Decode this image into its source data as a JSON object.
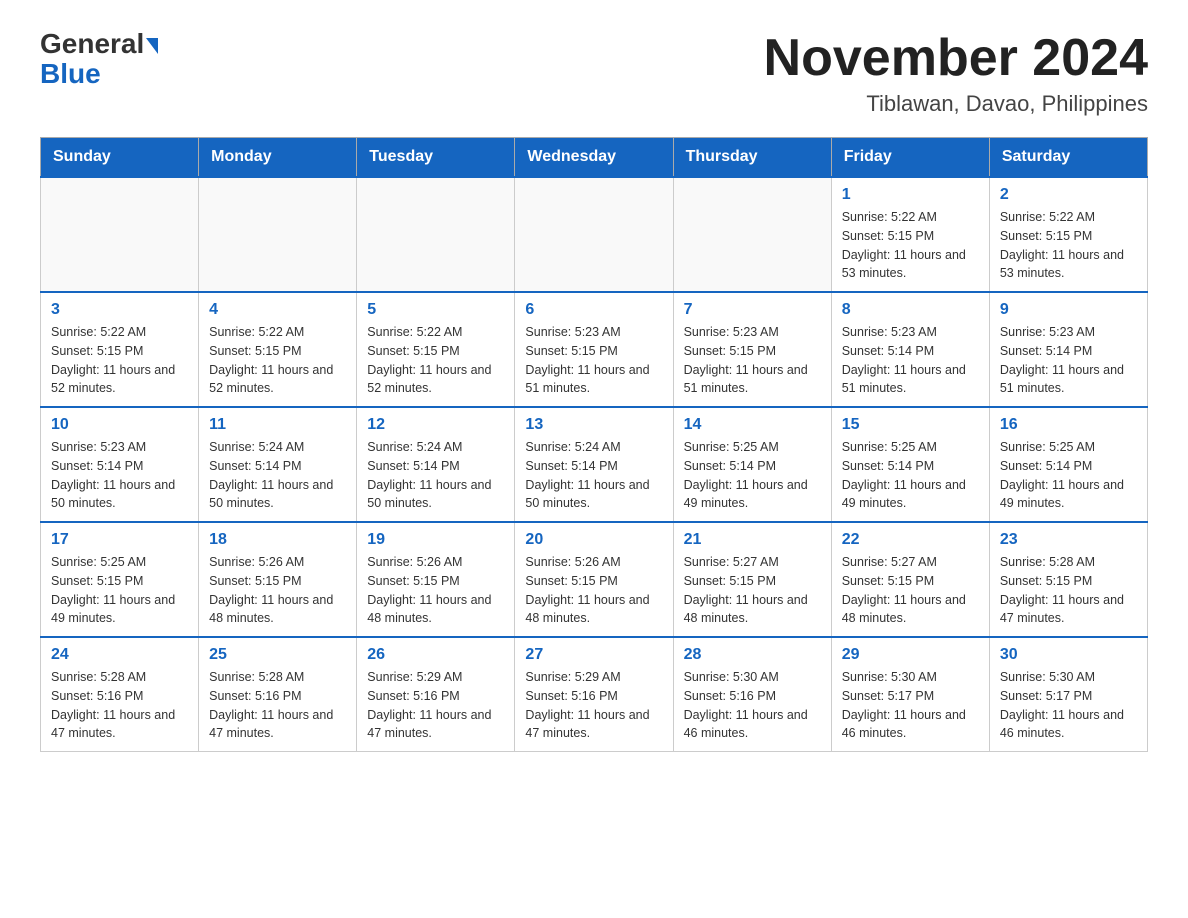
{
  "header": {
    "logo_general": "General",
    "logo_blue": "Blue",
    "month_year": "November 2024",
    "location": "Tiblawan, Davao, Philippines"
  },
  "weekdays": [
    "Sunday",
    "Monday",
    "Tuesday",
    "Wednesday",
    "Thursday",
    "Friday",
    "Saturday"
  ],
  "weeks": [
    [
      {
        "day": "",
        "info": ""
      },
      {
        "day": "",
        "info": ""
      },
      {
        "day": "",
        "info": ""
      },
      {
        "day": "",
        "info": ""
      },
      {
        "day": "",
        "info": ""
      },
      {
        "day": "1",
        "info": "Sunrise: 5:22 AM\nSunset: 5:15 PM\nDaylight: 11 hours and 53 minutes."
      },
      {
        "day": "2",
        "info": "Sunrise: 5:22 AM\nSunset: 5:15 PM\nDaylight: 11 hours and 53 minutes."
      }
    ],
    [
      {
        "day": "3",
        "info": "Sunrise: 5:22 AM\nSunset: 5:15 PM\nDaylight: 11 hours and 52 minutes."
      },
      {
        "day": "4",
        "info": "Sunrise: 5:22 AM\nSunset: 5:15 PM\nDaylight: 11 hours and 52 minutes."
      },
      {
        "day": "5",
        "info": "Sunrise: 5:22 AM\nSunset: 5:15 PM\nDaylight: 11 hours and 52 minutes."
      },
      {
        "day": "6",
        "info": "Sunrise: 5:23 AM\nSunset: 5:15 PM\nDaylight: 11 hours and 51 minutes."
      },
      {
        "day": "7",
        "info": "Sunrise: 5:23 AM\nSunset: 5:15 PM\nDaylight: 11 hours and 51 minutes."
      },
      {
        "day": "8",
        "info": "Sunrise: 5:23 AM\nSunset: 5:14 PM\nDaylight: 11 hours and 51 minutes."
      },
      {
        "day": "9",
        "info": "Sunrise: 5:23 AM\nSunset: 5:14 PM\nDaylight: 11 hours and 51 minutes."
      }
    ],
    [
      {
        "day": "10",
        "info": "Sunrise: 5:23 AM\nSunset: 5:14 PM\nDaylight: 11 hours and 50 minutes."
      },
      {
        "day": "11",
        "info": "Sunrise: 5:24 AM\nSunset: 5:14 PM\nDaylight: 11 hours and 50 minutes."
      },
      {
        "day": "12",
        "info": "Sunrise: 5:24 AM\nSunset: 5:14 PM\nDaylight: 11 hours and 50 minutes."
      },
      {
        "day": "13",
        "info": "Sunrise: 5:24 AM\nSunset: 5:14 PM\nDaylight: 11 hours and 50 minutes."
      },
      {
        "day": "14",
        "info": "Sunrise: 5:25 AM\nSunset: 5:14 PM\nDaylight: 11 hours and 49 minutes."
      },
      {
        "day": "15",
        "info": "Sunrise: 5:25 AM\nSunset: 5:14 PM\nDaylight: 11 hours and 49 minutes."
      },
      {
        "day": "16",
        "info": "Sunrise: 5:25 AM\nSunset: 5:14 PM\nDaylight: 11 hours and 49 minutes."
      }
    ],
    [
      {
        "day": "17",
        "info": "Sunrise: 5:25 AM\nSunset: 5:15 PM\nDaylight: 11 hours and 49 minutes."
      },
      {
        "day": "18",
        "info": "Sunrise: 5:26 AM\nSunset: 5:15 PM\nDaylight: 11 hours and 48 minutes."
      },
      {
        "day": "19",
        "info": "Sunrise: 5:26 AM\nSunset: 5:15 PM\nDaylight: 11 hours and 48 minutes."
      },
      {
        "day": "20",
        "info": "Sunrise: 5:26 AM\nSunset: 5:15 PM\nDaylight: 11 hours and 48 minutes."
      },
      {
        "day": "21",
        "info": "Sunrise: 5:27 AM\nSunset: 5:15 PM\nDaylight: 11 hours and 48 minutes."
      },
      {
        "day": "22",
        "info": "Sunrise: 5:27 AM\nSunset: 5:15 PM\nDaylight: 11 hours and 48 minutes."
      },
      {
        "day": "23",
        "info": "Sunrise: 5:28 AM\nSunset: 5:15 PM\nDaylight: 11 hours and 47 minutes."
      }
    ],
    [
      {
        "day": "24",
        "info": "Sunrise: 5:28 AM\nSunset: 5:16 PM\nDaylight: 11 hours and 47 minutes."
      },
      {
        "day": "25",
        "info": "Sunrise: 5:28 AM\nSunset: 5:16 PM\nDaylight: 11 hours and 47 minutes."
      },
      {
        "day": "26",
        "info": "Sunrise: 5:29 AM\nSunset: 5:16 PM\nDaylight: 11 hours and 47 minutes."
      },
      {
        "day": "27",
        "info": "Sunrise: 5:29 AM\nSunset: 5:16 PM\nDaylight: 11 hours and 47 minutes."
      },
      {
        "day": "28",
        "info": "Sunrise: 5:30 AM\nSunset: 5:16 PM\nDaylight: 11 hours and 46 minutes."
      },
      {
        "day": "29",
        "info": "Sunrise: 5:30 AM\nSunset: 5:17 PM\nDaylight: 11 hours and 46 minutes."
      },
      {
        "day": "30",
        "info": "Sunrise: 5:30 AM\nSunset: 5:17 PM\nDaylight: 11 hours and 46 minutes."
      }
    ]
  ]
}
